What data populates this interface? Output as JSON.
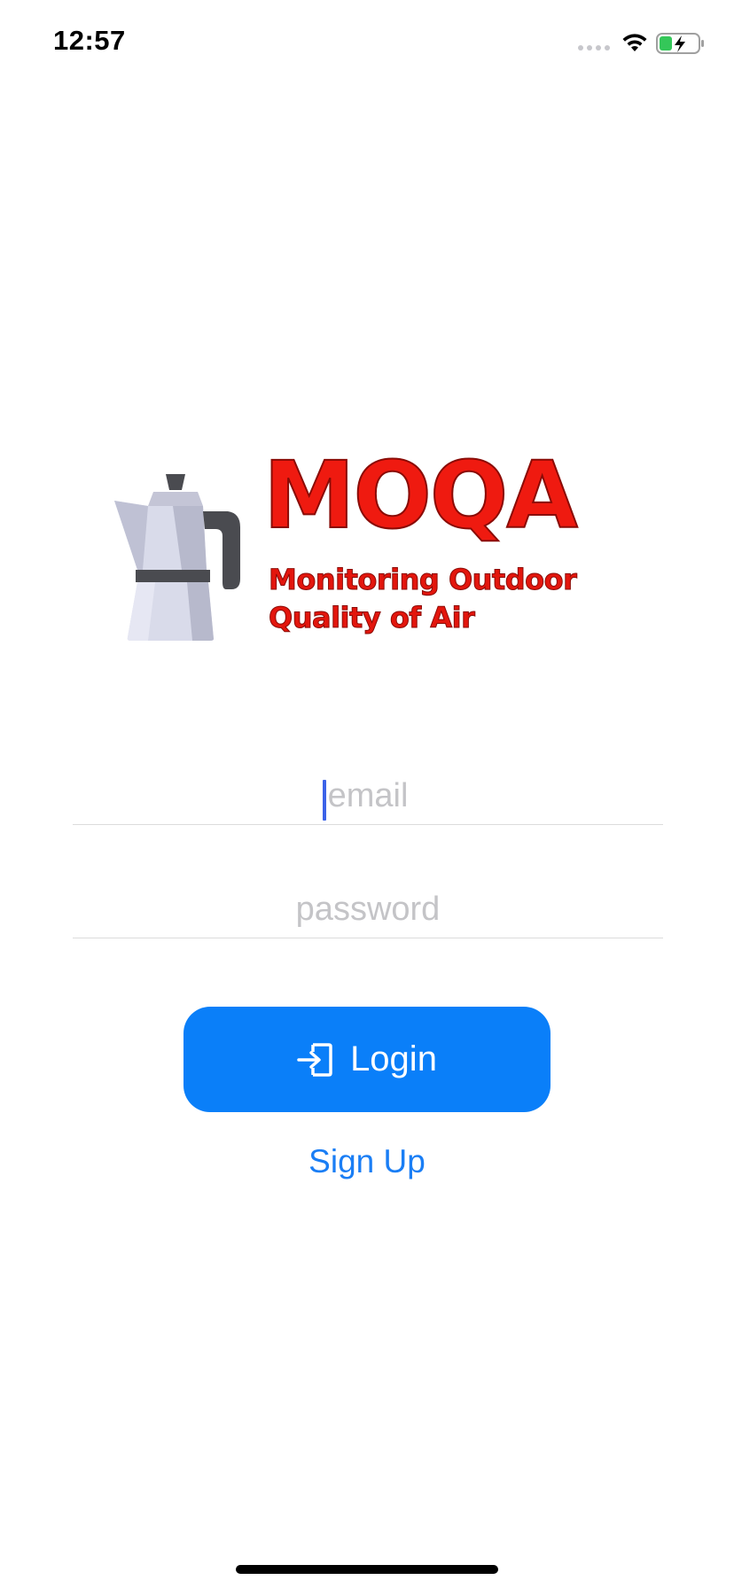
{
  "status_bar": {
    "time": "12:57",
    "icons": [
      "cellular-signal-icon",
      "wifi-icon",
      "battery-charging-icon"
    ]
  },
  "logo": {
    "title": "MOQA",
    "subtitle": "Monitoring Outdoor\nQuality of Air",
    "icon": "moka-pot-icon",
    "colors": {
      "text": "#ef1a10",
      "outline": "#8a0b06"
    }
  },
  "form": {
    "email": {
      "placeholder": "email",
      "value": ""
    },
    "password": {
      "placeholder": "password",
      "value": ""
    }
  },
  "login_button": {
    "label": "Login",
    "icon": "login-icon",
    "color": "#0a7ff9"
  },
  "signup_link": {
    "label": "Sign Up",
    "color": "#1a7ef5"
  }
}
